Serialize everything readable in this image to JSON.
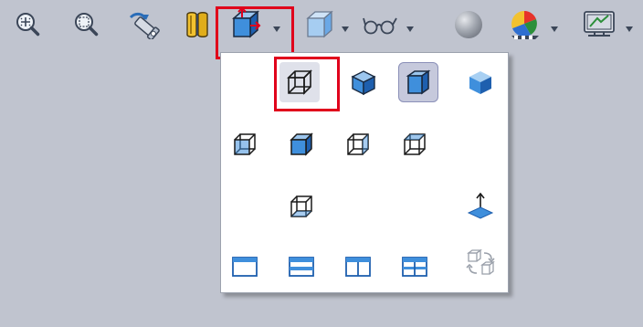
{
  "colors": {
    "background": "#c0c4cf",
    "highlight": "#e0001b",
    "menu_bg": "#ffffff",
    "blue_face": "#3f8fdc",
    "blue_dark": "#1e5fae",
    "pressed_bg": "#c6c9dc"
  },
  "toolbar": {
    "items": [
      {
        "icon": "zoom-to-fit-icon"
      },
      {
        "icon": "zoom-to-area-icon"
      },
      {
        "icon": "previous-view-icon"
      },
      {
        "icon": "section-view-icon"
      },
      {
        "icon": "view-orientation-icon",
        "has_dropdown": true,
        "highlighted": true
      },
      {
        "icon": "display-style-icon",
        "has_dropdown": true
      },
      {
        "icon": "hide-show-items-icon",
        "has_dropdown": true
      },
      {
        "icon": "edit-appearance-icon"
      },
      {
        "icon": "apply-scene-icon",
        "has_dropdown": true
      },
      {
        "icon": "view-settings-icon",
        "has_dropdown": true
      }
    ]
  },
  "menu": {
    "rows": [
      [
        "wireframe-icon",
        "hidden-lines-visible-icon",
        "shaded-with-edges-icon",
        "shaded-icon"
      ],
      [
        "isometric-icon",
        "trimetric-icon",
        "dimetric-icon",
        "normal-to-icon"
      ],
      [
        "single-view-icon",
        "view-selector-icon"
      ],
      [
        "single-viewport-icon",
        "two-view-horizontal-icon",
        "two-view-vertical-icon",
        "four-view-icon",
        "link-views-icon"
      ]
    ],
    "highlighted_item": "wireframe-icon",
    "pressed_item": "shaded-with-edges-icon",
    "disabled_item": "link-views-icon"
  }
}
